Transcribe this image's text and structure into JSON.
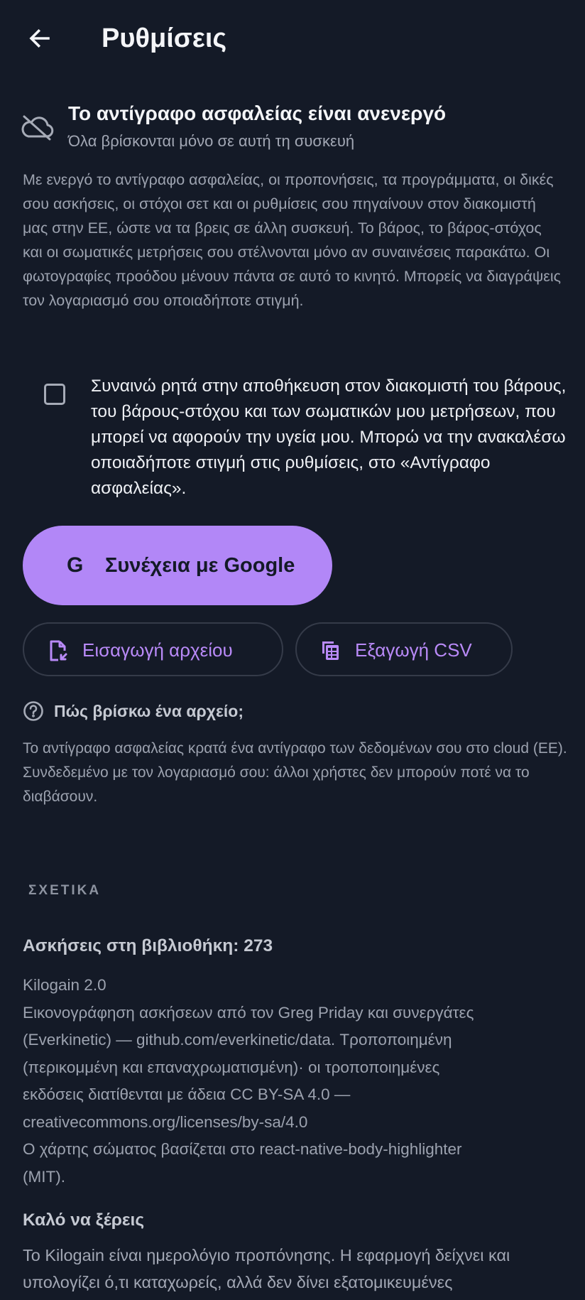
{
  "header": {
    "title": "Ρυθμίσεις",
    "back_icon": "arrow-left-icon"
  },
  "backup_status": {
    "icon": "cloud-off-icon",
    "title": "Το αντίγραφο ασφαλείας είναι ανενεργό",
    "subtitle": "Όλα βρίσκονται μόνο σε αυτή τη συσκευή"
  },
  "description": "Με ενεργό το αντίγραφο ασφαλείας, οι προπονήσεις, τα προγράμματα, οι δικές σου ασκήσεις, οι στόχοι σετ και οι ρυθμίσεις σου πηγαίνουν στον διακομιστή μας στην ΕΕ, ώστε να τα βρεις σε άλλη συσκευή. Το βάρος, το βάρος-στόχος και οι σωματικές μετρήσεις σου στέλνονται μόνο αν συναινέσεις παρακάτω. Οι φωτογραφίες προόδου μένουν πάντα σε αυτό το κινητό. Μπορείς να διαγράψεις τον λογαριασμό σου οποιαδήποτε στιγμή.",
  "consent": {
    "checked": false,
    "text": "Συναινώ ρητά στην αποθήκευση στον διακομιστή του βάρους, του βάρους-στόχου και των σωματικών μου μετρήσεων, που μπορεί να αφορούν την υγεία μου. Μπορώ να την ανακαλέσω οποιαδήποτε στιγμή στις ρυθμίσεις, στο «Αντίγραφο ασφαλείας»."
  },
  "actions": {
    "google_icon_letter": "G",
    "google_label": "Συνέχεια με Google",
    "import_label": "Εισαγωγή αρχείου",
    "import_icon": "file-import-icon",
    "export_label": "Εξαγωγή CSV",
    "export_icon": "spreadsheet-icon"
  },
  "help": {
    "icon": "question-circle-icon",
    "label": "Πώς βρίσκω ένα αρχείο;",
    "text": "Το αντίγραφο ασφαλείας κρατά ένα αντίγραφο των δεδομένων σου στο cloud (ΕΕ). Συνδεδεμένο με τον λογαριασμό σου: άλλοι χρήστες δεν μπορούν ποτέ να το διαβάσουν."
  },
  "about": {
    "section_label": "ΣΧΕΤΙΚΑ",
    "library_count": "Ασκήσεις στη βιβλιοθήκη: 273",
    "credits_lines": [
      "Kilogain 2.0",
      "Εικονογράφηση ασκήσεων από τον Greg Priday και συνεργάτες",
      "(Everkinetic) — github.com/everkinetic/data. Τροποποιημένη",
      "(περικομμένη και επαναχρωματισμένη)· οι τροποποιημένες",
      "εκδόσεις διατίθενται με άδεια CC BY-SA 4.0 —",
      "creativecommons.org/licenses/by-sa/4.0",
      "Ο χάρτης σώματος βασίζεται στο react-native-body-highlighter",
      "(MIT)."
    ],
    "good_to_know_title": "Καλό να ξέρεις",
    "good_to_know_text": "Το Kilogain είναι ημερολόγιο προπόνησης. Η εφαρμογή δείχνει και υπολογίζει ό,τι καταχωρείς, αλλά δεν δίνει εξατομικευμένες"
  },
  "colors": {
    "background": "#141a27",
    "accent": "#b287f7",
    "accent_text": "#b98af8"
  }
}
